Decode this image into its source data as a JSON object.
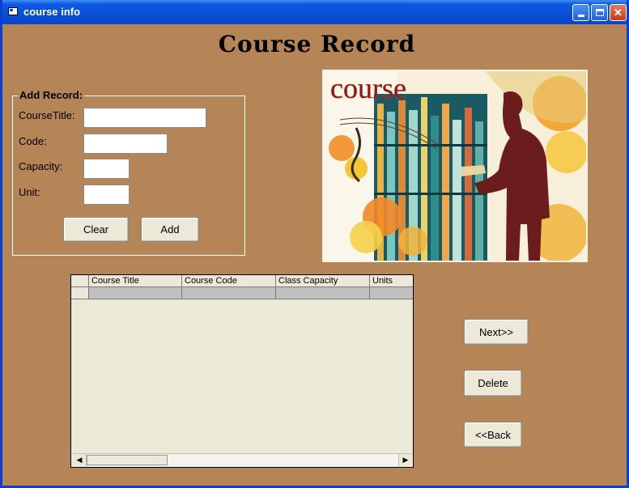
{
  "window": {
    "title": "course info"
  },
  "heading": "Course Record",
  "form": {
    "legend": "Add Record:",
    "fields": [
      {
        "label": "CourseTitle:",
        "value": ""
      },
      {
        "label": "Code:",
        "value": ""
      },
      {
        "label": "Capacity:",
        "value": ""
      },
      {
        "label": "Unit:",
        "value": ""
      }
    ],
    "clear_label": "Clear",
    "add_label": "Add"
  },
  "picture": {
    "text": "course"
  },
  "grid": {
    "columns": [
      "Course Title",
      "Course Code",
      "Class Capacity",
      "Units"
    ],
    "rows": [
      [
        "",
        "",
        "",
        ""
      ]
    ]
  },
  "buttons": {
    "next": "Next>>",
    "delete": "Delete",
    "back": "<<Back"
  },
  "icons": {
    "app": "window-app-icon",
    "minimize": "minimize-icon",
    "maximize": "maximize-icon",
    "close": "close-icon",
    "scroll_left": "scroll-left-arrow-icon",
    "scroll_right": "scroll-right-arrow-icon"
  },
  "colors": {
    "form_background": "#b58457",
    "title_bar": "#0a4ed6",
    "close_button": "#c63a1c",
    "picture_figure": "#6b1c1c"
  }
}
